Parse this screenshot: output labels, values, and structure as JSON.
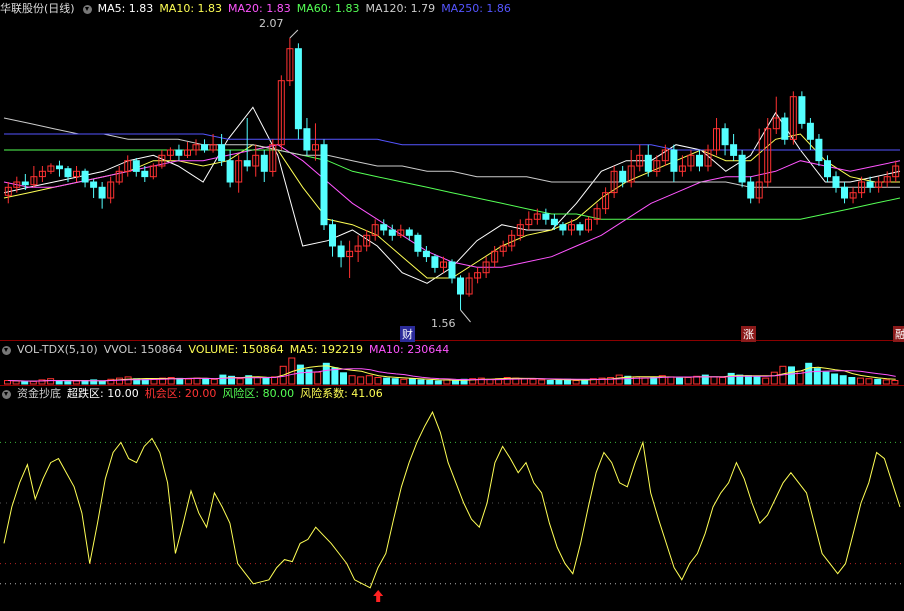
{
  "stock": {
    "name": "华联股份(日线)"
  },
  "ma_header": [
    {
      "text": "MA5: 1.83",
      "color": "#ffffff"
    },
    {
      "text": "MA10: 1.83",
      "color": "#ffff55"
    },
    {
      "text": "MA20: 1.83",
      "color": "#ff55ff"
    },
    {
      "text": "MA60: 1.83",
      "color": "#55ff55"
    },
    {
      "text": "MA120: 1.79",
      "color": "#cccccc"
    },
    {
      "text": "MA250: 1.86",
      "color": "#5555ff"
    }
  ],
  "price_marks": {
    "high": "2.07",
    "low": "1.56"
  },
  "tags": {
    "cai": "财",
    "zhang": "涨",
    "edge": "融"
  },
  "vol_header": [
    {
      "text": "VOL-TDX(5,10)",
      "color": "#cccccc"
    },
    {
      "text": "VVOL: 150864",
      "color": "#cccccc"
    },
    {
      "text": "VOLUME: 150864",
      "color": "#ffff55"
    },
    {
      "text": "MA5: 192219",
      "color": "#ffff55"
    },
    {
      "text": "MA10: 230644",
      "color": "#ff55ff"
    }
  ],
  "ind_header": [
    {
      "text": "资金抄底",
      "color": "#cccccc"
    },
    {
      "text": "超跌区: 10.00",
      "color": "#ffffff"
    },
    {
      "text": "机会区: 20.00",
      "color": "#ff3333"
    },
    {
      "text": "风险区: 80.00",
      "color": "#55ff55"
    },
    {
      "text": "风险系数: 41.06",
      "color": "#ffff55"
    }
  ],
  "colors": {
    "up": "#ff3232",
    "down": "#54ffff",
    "divider": "#8b0000"
  },
  "chart_data": {
    "type": "candlestick",
    "price_range": [
      1.56,
      2.07
    ],
    "candles": [
      {
        "o": 1.775,
        "c": 1.79,
        "h": 1.8,
        "l": 1.76
      },
      {
        "o": 1.79,
        "c": 1.8,
        "h": 1.81,
        "l": 1.78
      },
      {
        "o": 1.8,
        "c": 1.795,
        "h": 1.815,
        "l": 1.785
      },
      {
        "o": 1.795,
        "c": 1.81,
        "h": 1.83,
        "l": 1.79
      },
      {
        "o": 1.81,
        "c": 1.82,
        "h": 1.83,
        "l": 1.8
      },
      {
        "o": 1.82,
        "c": 1.83,
        "h": 1.835,
        "l": 1.815
      },
      {
        "o": 1.83,
        "c": 1.825,
        "h": 1.84,
        "l": 1.81
      },
      {
        "o": 1.825,
        "c": 1.81,
        "h": 1.83,
        "l": 1.8
      },
      {
        "o": 1.81,
        "c": 1.82,
        "h": 1.83,
        "l": 1.8
      },
      {
        "o": 1.82,
        "c": 1.8,
        "h": 1.825,
        "l": 1.79
      },
      {
        "o": 1.8,
        "c": 1.79,
        "h": 1.805,
        "l": 1.77
      },
      {
        "o": 1.79,
        "c": 1.77,
        "h": 1.8,
        "l": 1.75
      },
      {
        "o": 1.77,
        "c": 1.8,
        "h": 1.81,
        "l": 1.76
      },
      {
        "o": 1.8,
        "c": 1.82,
        "h": 1.83,
        "l": 1.795
      },
      {
        "o": 1.82,
        "c": 1.84,
        "h": 1.85,
        "l": 1.81
      },
      {
        "o": 1.84,
        "c": 1.82,
        "h": 1.845,
        "l": 1.81
      },
      {
        "o": 1.82,
        "c": 1.81,
        "h": 1.83,
        "l": 1.8
      },
      {
        "o": 1.81,
        "c": 1.83,
        "h": 1.835,
        "l": 1.805
      },
      {
        "o": 1.83,
        "c": 1.85,
        "h": 1.86,
        "l": 1.825
      },
      {
        "o": 1.85,
        "c": 1.86,
        "h": 1.865,
        "l": 1.84
      },
      {
        "o": 1.86,
        "c": 1.85,
        "h": 1.87,
        "l": 1.84
      },
      {
        "o": 1.85,
        "c": 1.86,
        "h": 1.875,
        "l": 1.845
      },
      {
        "o": 1.86,
        "c": 1.87,
        "h": 1.88,
        "l": 1.85
      },
      {
        "o": 1.87,
        "c": 1.86,
        "h": 1.88,
        "l": 1.855
      },
      {
        "o": 1.86,
        "c": 1.87,
        "h": 1.89,
        "l": 1.855
      },
      {
        "o": 1.87,
        "c": 1.84,
        "h": 1.89,
        "l": 1.83
      },
      {
        "o": 1.84,
        "c": 1.8,
        "h": 1.86,
        "l": 1.79
      },
      {
        "o": 1.8,
        "c": 1.84,
        "h": 1.85,
        "l": 1.78
      },
      {
        "o": 1.84,
        "c": 1.83,
        "h": 1.92,
        "l": 1.82
      },
      {
        "o": 1.83,
        "c": 1.85,
        "h": 1.87,
        "l": 1.81
      },
      {
        "o": 1.85,
        "c": 1.82,
        "h": 1.86,
        "l": 1.8
      },
      {
        "o": 1.82,
        "c": 1.87,
        "h": 1.88,
        "l": 1.81
      },
      {
        "o": 1.87,
        "c": 1.99,
        "h": 2.0,
        "l": 1.86
      },
      {
        "o": 1.99,
        "c": 2.05,
        "h": 2.07,
        "l": 1.98
      },
      {
        "o": 2.05,
        "c": 1.9,
        "h": 2.06,
        "l": 1.88
      },
      {
        "o": 1.9,
        "c": 1.86,
        "h": 1.92,
        "l": 1.85
      },
      {
        "o": 1.86,
        "c": 1.87,
        "h": 1.91,
        "l": 1.84
      },
      {
        "o": 1.87,
        "c": 1.72,
        "h": 1.88,
        "l": 1.71
      },
      {
        "o": 1.72,
        "c": 1.68,
        "h": 1.73,
        "l": 1.66
      },
      {
        "o": 1.68,
        "c": 1.66,
        "h": 1.69,
        "l": 1.64
      },
      {
        "o": 1.66,
        "c": 1.67,
        "h": 1.69,
        "l": 1.62
      },
      {
        "o": 1.67,
        "c": 1.68,
        "h": 1.7,
        "l": 1.65
      },
      {
        "o": 1.68,
        "c": 1.7,
        "h": 1.71,
        "l": 1.67
      },
      {
        "o": 1.7,
        "c": 1.72,
        "h": 1.73,
        "l": 1.69
      },
      {
        "o": 1.72,
        "c": 1.71,
        "h": 1.73,
        "l": 1.7
      },
      {
        "o": 1.71,
        "c": 1.7,
        "h": 1.72,
        "l": 1.69
      },
      {
        "o": 1.7,
        "c": 1.71,
        "h": 1.72,
        "l": 1.695
      },
      {
        "o": 1.71,
        "c": 1.7,
        "h": 1.715,
        "l": 1.69
      },
      {
        "o": 1.7,
        "c": 1.67,
        "h": 1.705,
        "l": 1.66
      },
      {
        "o": 1.67,
        "c": 1.66,
        "h": 1.68,
        "l": 1.65
      },
      {
        "o": 1.66,
        "c": 1.64,
        "h": 1.665,
        "l": 1.63
      },
      {
        "o": 1.64,
        "c": 1.65,
        "h": 1.66,
        "l": 1.63
      },
      {
        "o": 1.65,
        "c": 1.62,
        "h": 1.655,
        "l": 1.61
      },
      {
        "o": 1.62,
        "c": 1.59,
        "h": 1.625,
        "l": 1.56
      },
      {
        "o": 1.59,
        "c": 1.62,
        "h": 1.63,
        "l": 1.585
      },
      {
        "o": 1.62,
        "c": 1.63,
        "h": 1.64,
        "l": 1.61
      },
      {
        "o": 1.63,
        "c": 1.65,
        "h": 1.66,
        "l": 1.62
      },
      {
        "o": 1.65,
        "c": 1.67,
        "h": 1.68,
        "l": 1.64
      },
      {
        "o": 1.67,
        "c": 1.68,
        "h": 1.69,
        "l": 1.66
      },
      {
        "o": 1.68,
        "c": 1.7,
        "h": 1.71,
        "l": 1.67
      },
      {
        "o": 1.7,
        "c": 1.72,
        "h": 1.73,
        "l": 1.69
      },
      {
        "o": 1.72,
        "c": 1.73,
        "h": 1.745,
        "l": 1.71
      },
      {
        "o": 1.73,
        "c": 1.74,
        "h": 1.75,
        "l": 1.72
      },
      {
        "o": 1.74,
        "c": 1.73,
        "h": 1.75,
        "l": 1.72
      },
      {
        "o": 1.73,
        "c": 1.72,
        "h": 1.74,
        "l": 1.71
      },
      {
        "o": 1.72,
        "c": 1.71,
        "h": 1.725,
        "l": 1.7
      },
      {
        "o": 1.71,
        "c": 1.72,
        "h": 1.73,
        "l": 1.7
      },
      {
        "o": 1.72,
        "c": 1.71,
        "h": 1.725,
        "l": 1.7
      },
      {
        "o": 1.71,
        "c": 1.73,
        "h": 1.735,
        "l": 1.705
      },
      {
        "o": 1.73,
        "c": 1.75,
        "h": 1.76,
        "l": 1.72
      },
      {
        "o": 1.75,
        "c": 1.78,
        "h": 1.79,
        "l": 1.74
      },
      {
        "o": 1.78,
        "c": 1.82,
        "h": 1.83,
        "l": 1.77
      },
      {
        "o": 1.82,
        "c": 1.8,
        "h": 1.83,
        "l": 1.79
      },
      {
        "o": 1.8,
        "c": 1.83,
        "h": 1.86,
        "l": 1.79
      },
      {
        "o": 1.83,
        "c": 1.85,
        "h": 1.87,
        "l": 1.82
      },
      {
        "o": 1.85,
        "c": 1.82,
        "h": 1.87,
        "l": 1.81
      },
      {
        "o": 1.82,
        "c": 1.84,
        "h": 1.85,
        "l": 1.81
      },
      {
        "o": 1.84,
        "c": 1.86,
        "h": 1.87,
        "l": 1.83
      },
      {
        "o": 1.86,
        "c": 1.82,
        "h": 1.87,
        "l": 1.8
      },
      {
        "o": 1.82,
        "c": 1.83,
        "h": 1.85,
        "l": 1.81
      },
      {
        "o": 1.83,
        "c": 1.85,
        "h": 1.86,
        "l": 1.82
      },
      {
        "o": 1.85,
        "c": 1.83,
        "h": 1.86,
        "l": 1.82
      },
      {
        "o": 1.83,
        "c": 1.86,
        "h": 1.87,
        "l": 1.82
      },
      {
        "o": 1.86,
        "c": 1.9,
        "h": 1.92,
        "l": 1.85
      },
      {
        "o": 1.9,
        "c": 1.87,
        "h": 1.91,
        "l": 1.85
      },
      {
        "o": 1.87,
        "c": 1.85,
        "h": 1.89,
        "l": 1.84
      },
      {
        "o": 1.85,
        "c": 1.8,
        "h": 1.86,
        "l": 1.79
      },
      {
        "o": 1.8,
        "c": 1.77,
        "h": 1.81,
        "l": 1.76
      },
      {
        "o": 1.77,
        "c": 1.8,
        "h": 1.9,
        "l": 1.76
      },
      {
        "o": 1.8,
        "c": 1.9,
        "h": 1.92,
        "l": 1.79
      },
      {
        "o": 1.9,
        "c": 1.92,
        "h": 1.96,
        "l": 1.89
      },
      {
        "o": 1.92,
        "c": 1.88,
        "h": 1.93,
        "l": 1.87
      },
      {
        "o": 1.88,
        "c": 1.96,
        "h": 1.97,
        "l": 1.87
      },
      {
        "o": 1.96,
        "c": 1.91,
        "h": 1.97,
        "l": 1.9
      },
      {
        "o": 1.91,
        "c": 1.88,
        "h": 1.92,
        "l": 1.86
      },
      {
        "o": 1.88,
        "c": 1.84,
        "h": 1.89,
        "l": 1.83
      },
      {
        "o": 1.84,
        "c": 1.81,
        "h": 1.85,
        "l": 1.8
      },
      {
        "o": 1.81,
        "c": 1.79,
        "h": 1.82,
        "l": 1.78
      },
      {
        "o": 1.79,
        "c": 1.77,
        "h": 1.8,
        "l": 1.76
      },
      {
        "o": 1.77,
        "c": 1.78,
        "h": 1.79,
        "l": 1.76
      },
      {
        "o": 1.78,
        "c": 1.8,
        "h": 1.81,
        "l": 1.77
      },
      {
        "o": 1.8,
        "c": 1.79,
        "h": 1.81,
        "l": 1.78
      },
      {
        "o": 1.79,
        "c": 1.8,
        "h": 1.81,
        "l": 1.78
      },
      {
        "o": 1.8,
        "c": 1.81,
        "h": 1.82,
        "l": 1.79
      },
      {
        "o": 1.81,
        "c": 1.83,
        "h": 1.84,
        "l": 1.8
      }
    ],
    "ma": {
      "MA5": {
        "color": "#ffffff",
        "values": [
          1.78,
          1.79,
          1.8,
          1.81,
          1.82,
          1.84,
          1.85,
          1.83,
          1.8,
          1.88,
          1.94,
          1.85,
          1.68,
          1.69,
          1.71,
          1.68,
          1.63,
          1.61,
          1.64,
          1.69,
          1.72,
          1.71,
          1.71,
          1.76,
          1.82,
          1.84,
          1.84,
          1.87,
          1.86,
          1.82,
          1.85,
          1.93,
          1.86,
          1.8,
          1.8,
          1.81,
          1.82
        ]
      },
      "MA10": {
        "color": "#ffff55",
        "values": [
          1.77,
          1.78,
          1.79,
          1.8,
          1.81,
          1.82,
          1.84,
          1.84,
          1.83,
          1.84,
          1.87,
          1.86,
          1.79,
          1.73,
          1.72,
          1.7,
          1.66,
          1.62,
          1.62,
          1.65,
          1.68,
          1.7,
          1.71,
          1.73,
          1.77,
          1.8,
          1.82,
          1.84,
          1.86,
          1.84,
          1.84,
          1.88,
          1.89,
          1.84,
          1.81,
          1.8,
          1.8
        ]
      },
      "MA20": {
        "color": "#ff55ff",
        "values": [
          1.8,
          1.79,
          1.79,
          1.8,
          1.81,
          1.82,
          1.83,
          1.84,
          1.84,
          1.85,
          1.86,
          1.87,
          1.84,
          1.8,
          1.76,
          1.73,
          1.7,
          1.67,
          1.65,
          1.64,
          1.64,
          1.65,
          1.66,
          1.68,
          1.7,
          1.73,
          1.76,
          1.78,
          1.8,
          1.81,
          1.81,
          1.82,
          1.84,
          1.83,
          1.82,
          1.83,
          1.84
        ]
      },
      "MA60": {
        "color": "#55ff55",
        "values": [
          1.86,
          1.86,
          1.86,
          1.86,
          1.86,
          1.86,
          1.86,
          1.86,
          1.86,
          1.86,
          1.86,
          1.86,
          1.85,
          1.84,
          1.82,
          1.81,
          1.8,
          1.79,
          1.78,
          1.77,
          1.76,
          1.75,
          1.74,
          1.74,
          1.73,
          1.73,
          1.73,
          1.73,
          1.73,
          1.73,
          1.73,
          1.73,
          1.73,
          1.74,
          1.75,
          1.76,
          1.77
        ]
      },
      "MA120": {
        "color": "#cccccc",
        "values": [
          1.92,
          1.91,
          1.9,
          1.89,
          1.89,
          1.88,
          1.88,
          1.88,
          1.87,
          1.87,
          1.87,
          1.86,
          1.85,
          1.85,
          1.84,
          1.83,
          1.83,
          1.82,
          1.82,
          1.81,
          1.81,
          1.81,
          1.8,
          1.8,
          1.8,
          1.8,
          1.8,
          1.8,
          1.8,
          1.8,
          1.79,
          1.79,
          1.79,
          1.79,
          1.79,
          1.79,
          1.79
        ]
      },
      "MA250": {
        "color": "#5555ff",
        "values": [
          1.89,
          1.89,
          1.89,
          1.89,
          1.89,
          1.89,
          1.89,
          1.89,
          1.89,
          1.88,
          1.88,
          1.88,
          1.88,
          1.88,
          1.88,
          1.88,
          1.87,
          1.87,
          1.87,
          1.87,
          1.87,
          1.87,
          1.87,
          1.87,
          1.87,
          1.87,
          1.87,
          1.86,
          1.86,
          1.86,
          1.86,
          1.86,
          1.86,
          1.86,
          1.86,
          1.86,
          1.86
        ]
      }
    },
    "volume": [
      12,
      10,
      8,
      9,
      14,
      18,
      10,
      8,
      10,
      12,
      14,
      9,
      16,
      20,
      24,
      18,
      15,
      16,
      20,
      22,
      19,
      17,
      20,
      18,
      16,
      30,
      26,
      18,
      28,
      22,
      20,
      24,
      60,
      88,
      64,
      48,
      40,
      70,
      55,
      38,
      28,
      24,
      28,
      22,
      20,
      18,
      16,
      18,
      14,
      12,
      10,
      14,
      12,
      16,
      18,
      20,
      16,
      18,
      22,
      20,
      18,
      16,
      14,
      12,
      14,
      16,
      12,
      14,
      18,
      20,
      22,
      30,
      26,
      24,
      20,
      22,
      28,
      24,
      20,
      22,
      26,
      30,
      24,
      22,
      36,
      30,
      28,
      24,
      20,
      40,
      60,
      58,
      44,
      70,
      52,
      40,
      34,
      28,
      22,
      20,
      18,
      16,
      14,
      12
    ],
    "indicator": [
      30,
      48,
      60,
      69,
      52,
      62,
      70,
      72,
      65,
      58,
      45,
      20,
      40,
      62,
      75,
      80,
      72,
      70,
      78,
      82,
      75,
      60,
      25,
      40,
      56,
      45,
      38,
      55,
      48,
      40,
      20,
      15,
      10,
      11,
      12,
      18,
      22,
      21,
      30,
      32,
      38,
      34,
      30,
      25,
      20,
      12,
      10,
      8,
      18,
      25,
      42,
      58,
      70,
      80,
      88,
      95,
      85,
      70,
      60,
      50,
      42,
      38,
      50,
      70,
      78,
      72,
      65,
      70,
      60,
      55,
      40,
      28,
      20,
      15,
      30,
      48,
      65,
      75,
      70,
      60,
      58,
      70,
      80,
      55,
      42,
      30,
      18,
      12,
      20,
      25,
      35,
      48,
      55,
      60,
      70,
      62,
      50,
      40,
      44,
      52,
      60,
      65,
      60,
      55,
      40,
      25,
      20,
      15,
      20,
      35,
      50,
      60,
      75,
      72,
      60,
      48
    ]
  }
}
